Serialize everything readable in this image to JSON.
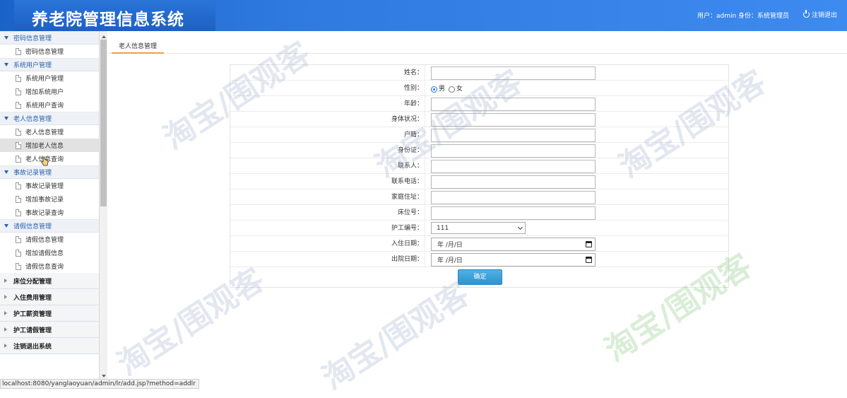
{
  "header": {
    "title": "养老院管理信息系统",
    "user_info": "用户：admin 身份：系统管理员",
    "logout_label": "注销退出"
  },
  "sidebar": {
    "groups": [
      {
        "title": "密码信息管理",
        "items": [
          "密码信息管理"
        ]
      },
      {
        "title": "系统用户管理",
        "items": [
          "系统用户管理",
          "增加系统用户",
          "系统用户查询"
        ]
      },
      {
        "title": "老人信息管理",
        "items": [
          "老人信息管理",
          "增加老人信息",
          "老人信息查询"
        ]
      },
      {
        "title": "事故记录管理",
        "items": [
          "事故记录管理",
          "增加事故记录",
          "事故记录查询"
        ]
      },
      {
        "title": "请假信息管理",
        "items": [
          "请假信息管理",
          "增加请假信息",
          "请假信息查询"
        ]
      }
    ],
    "collapsed_groups": [
      "床位分配管理",
      "入住费用管理",
      "护工薪资管理",
      "护工请假管理",
      "注销退出系统"
    ]
  },
  "tab": {
    "label": "老人信息管理"
  },
  "form": {
    "labels": {
      "name": "姓名：",
      "gender": "性别：",
      "age": "年龄：",
      "health": "身体状况：",
      "hukou": "户籍：",
      "idcard": "身份证：",
      "contact": "联系人：",
      "phone": "联系电话：",
      "address": "家庭住址：",
      "bed": "床位号：",
      "nurse": "护工编号：",
      "checkin": "入住日期：",
      "checkout": "出院日期："
    },
    "gender_options": [
      "男",
      "女"
    ],
    "gender_selected": "男",
    "nurse_selected": "111",
    "date_placeholder": "年 /月/日",
    "submit_label": "确定"
  },
  "status_bar": "localhost:8080/yanglaoyuan/admin/lr/add.jsp?method=addlr",
  "watermark": "淘宝/围观客",
  "colors": {
    "header": "#2a74d8",
    "accent_tab": "#f0a23a",
    "button": "#3aa0d8",
    "link_blue": "#2b62b0"
  }
}
